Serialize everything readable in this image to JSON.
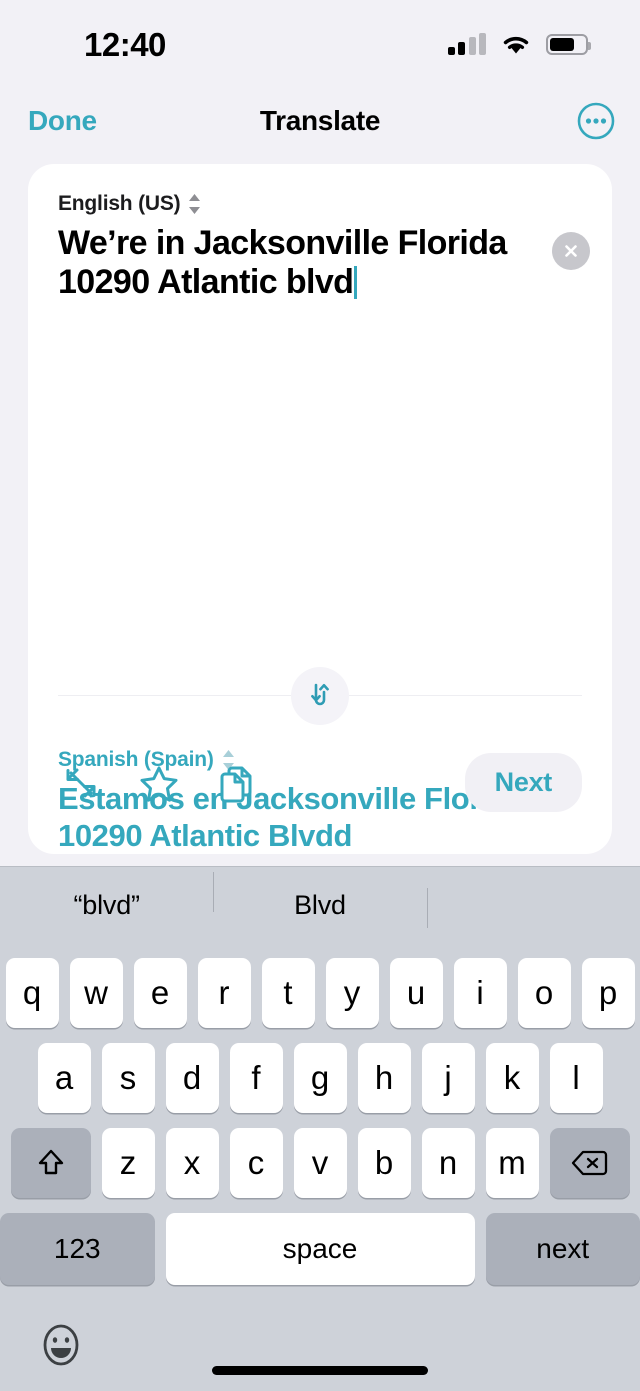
{
  "status_bar": {
    "time": "12:40",
    "cellular_icon": "cellular-signal-icon",
    "wifi_icon": "wifi-icon",
    "battery_icon": "battery-icon"
  },
  "nav": {
    "done_label": "Done",
    "title": "Translate",
    "more_icon": "more-ellipsis-circle-icon"
  },
  "card": {
    "source": {
      "language": "English (US)",
      "text": "We’re in Jacksonville Florida 10290 Atlantic blvd",
      "clear_icon": "clear-circle-x-icon",
      "selector_icon": "chevron-up-down-icon"
    },
    "swap_icon": "swap-languages-icon",
    "target": {
      "language": "Spanish (Spain)",
      "text": "Estamos en Jacksonville Florida 10290 Atlantic Blvdd",
      "selector_icon": "chevron-up-down-icon"
    },
    "actions": {
      "expand_icon": "expand-fullscreen-icon",
      "favorite_icon": "star-favorite-icon",
      "copy_icon": "copy-documents-icon",
      "next_label": "Next"
    }
  },
  "keyboard": {
    "suggestions": [
      "“blvd”",
      "Blvd",
      ""
    ],
    "row1": [
      "q",
      "w",
      "e",
      "r",
      "t",
      "y",
      "u",
      "i",
      "o",
      "p"
    ],
    "row2": [
      "a",
      "s",
      "d",
      "f",
      "g",
      "h",
      "j",
      "k",
      "l"
    ],
    "row3": [
      "z",
      "x",
      "c",
      "v",
      "b",
      "n",
      "m"
    ],
    "shift_icon": "shift-arrow-icon",
    "delete_icon": "delete-backspace-icon",
    "numbers_label": "123",
    "space_label": "space",
    "return_label": "next",
    "emoji_icon": "emoji-smiley-icon"
  },
  "colors": {
    "accent": "#35a8bd",
    "background": "#f2f1f6",
    "keyboard_bg": "#ced2d9",
    "key_bg": "#ffffff",
    "fn_key_bg": "#abb0ba"
  }
}
